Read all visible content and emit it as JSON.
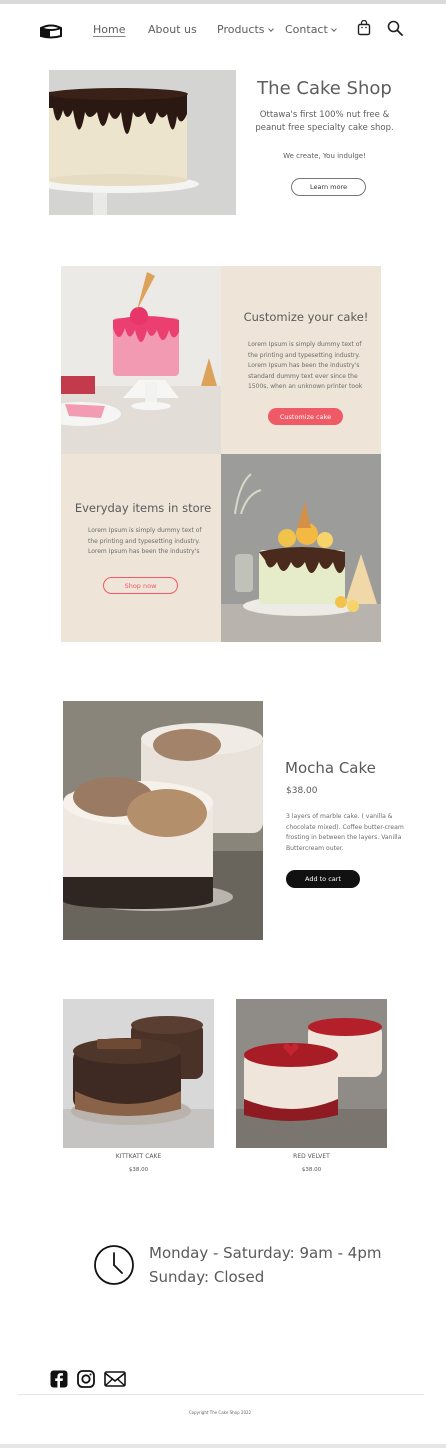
{
  "nav": {
    "logo": "cake-logo-icon",
    "home": "Home",
    "about": "About us",
    "products": "Products",
    "contact": "Contact",
    "bag": "shopping-bag-icon",
    "search": "search-icon"
  },
  "hero": {
    "title": "The Cake Shop",
    "subtitle": "Ottawa's first 100% nut free & peanut free specialty cake shop.",
    "tagline": "We create, You indulge!",
    "button": "Learn more",
    "slide_count": 3,
    "prev_arrow": "‹",
    "next_arrow": "›"
  },
  "customize": {
    "title": "Customize your cake!",
    "text": "Lorem Ipsum is simply dummy text of the printing and typesetting industry. Lorem Ipsum has been the industry's standard dummy text ever since the 1500s, when an unknown printer took",
    "button": "Customize cake"
  },
  "everyday": {
    "title": "Everyday items in store",
    "text": "Lorem Ipsum is simply dummy text of the printing and typesetting industry. Lorem Ipsum has been the industry's",
    "button": "Shop now"
  },
  "featured": {
    "name": "Mocha Cake",
    "price": "$38.00",
    "description": "3 layers of marble cake. ( vanilla & chocolate mixed). Coffee butter-cream frosting in between the layers. Vanilla Buttercream outer.",
    "button": "Add to cart"
  },
  "products": [
    {
      "name": "KITTKATT CAKE",
      "price": "$38.00"
    },
    {
      "name": "RED VELVET",
      "price": "$38.00"
    }
  ],
  "hours": {
    "weekdays": "Monday - Saturday: 9am - 4pm",
    "sunday": "Sunday: Closed"
  },
  "footer": {
    "social": [
      "facebook-icon",
      "instagram-icon",
      "email-icon"
    ],
    "copyright": "Copyright The Cake Shop 2022"
  },
  "colors": {
    "accent": "#f05a66",
    "beige": "#eee4d8",
    "button_dark": "#111111"
  }
}
